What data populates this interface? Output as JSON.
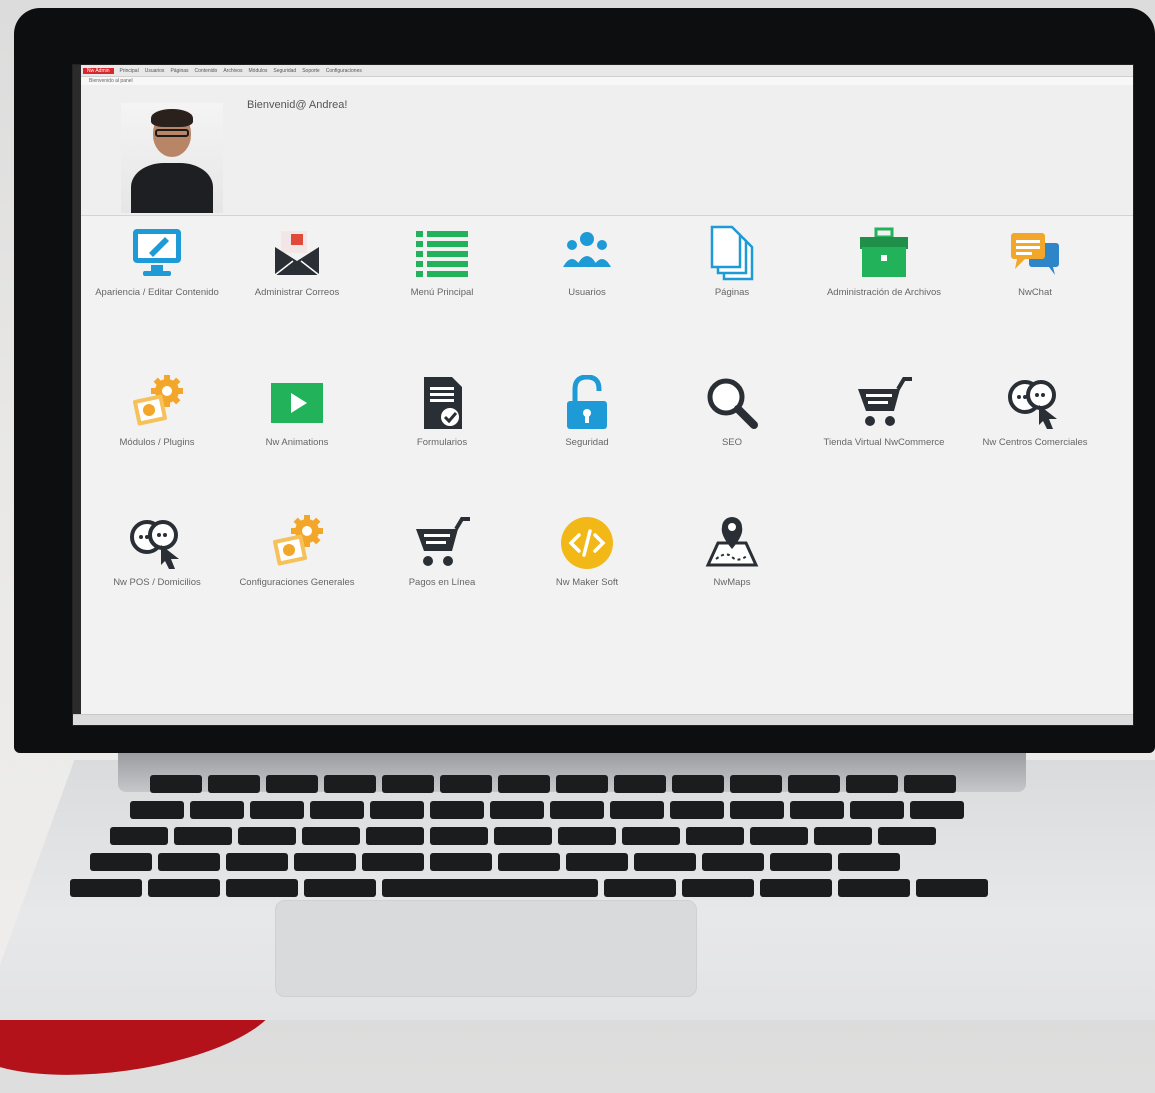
{
  "menu": {
    "items": [
      "Nw Admin",
      "Principal",
      "Usuarios",
      "Páginas",
      "Contenido",
      "Archivos",
      "Módulos",
      "Seguridad",
      "Soporte",
      "Configuraciones"
    ],
    "subbar": "Bienvenido al panel"
  },
  "header": {
    "welcome": "Bienvenid@ Andrea!"
  },
  "tiles": [
    {
      "label": "Apariencia / Editar Contenido",
      "icon": "monitor-edit-icon",
      "color": "#1e9ad6"
    },
    {
      "label": "Administrar Correos",
      "icon": "mail-icon",
      "color": "#2a2f35"
    },
    {
      "label": "Menú Principal",
      "icon": "list-icon",
      "color": "#22b35a"
    },
    {
      "label": "Usuarios",
      "icon": "users-icon",
      "color": "#1e9ad6"
    },
    {
      "label": "Páginas",
      "icon": "pages-icon",
      "color": "#1e9ad6"
    },
    {
      "label": "Administración de Archivos",
      "icon": "briefcase-icon",
      "color": "#22b35a"
    },
    {
      "label": "NwChat",
      "icon": "chat-icon",
      "color": "#f2a62a"
    },
    {
      "label": "Módulos / Plugins",
      "icon": "plugin-gear-icon",
      "color": "#f2a62a"
    },
    {
      "label": "Nw Animations",
      "icon": "play-icon",
      "color": "#22b35a"
    },
    {
      "label": "Formularios",
      "icon": "form-check-icon",
      "color": "#2a2f35"
    },
    {
      "label": "Seguridad",
      "icon": "unlock-icon",
      "color": "#1e9ad6"
    },
    {
      "label": "SEO",
      "icon": "magnifier-icon",
      "color": "#2a2f35"
    },
    {
      "label": "Tienda Virtual NwCommerce",
      "icon": "cart-icon",
      "color": "#2a2f35"
    },
    {
      "label": "Nw Centros Comerciales",
      "icon": "chat-cursor-icon",
      "color": "#2a2f35"
    },
    {
      "label": "Nw POS / Domicilios",
      "icon": "chat-cursor-icon",
      "color": "#2a2f35"
    },
    {
      "label": "Configuraciones Generales",
      "icon": "plugin-gear-icon",
      "color": "#f2a62a"
    },
    {
      "label": "Pagos en Línea",
      "icon": "cart-icon",
      "color": "#2a2f35"
    },
    {
      "label": "Nw Maker Soft",
      "icon": "code-icon",
      "color": "#f2b817"
    },
    {
      "label": "NwMaps",
      "icon": "map-pin-icon",
      "color": "#2a2f35"
    }
  ]
}
